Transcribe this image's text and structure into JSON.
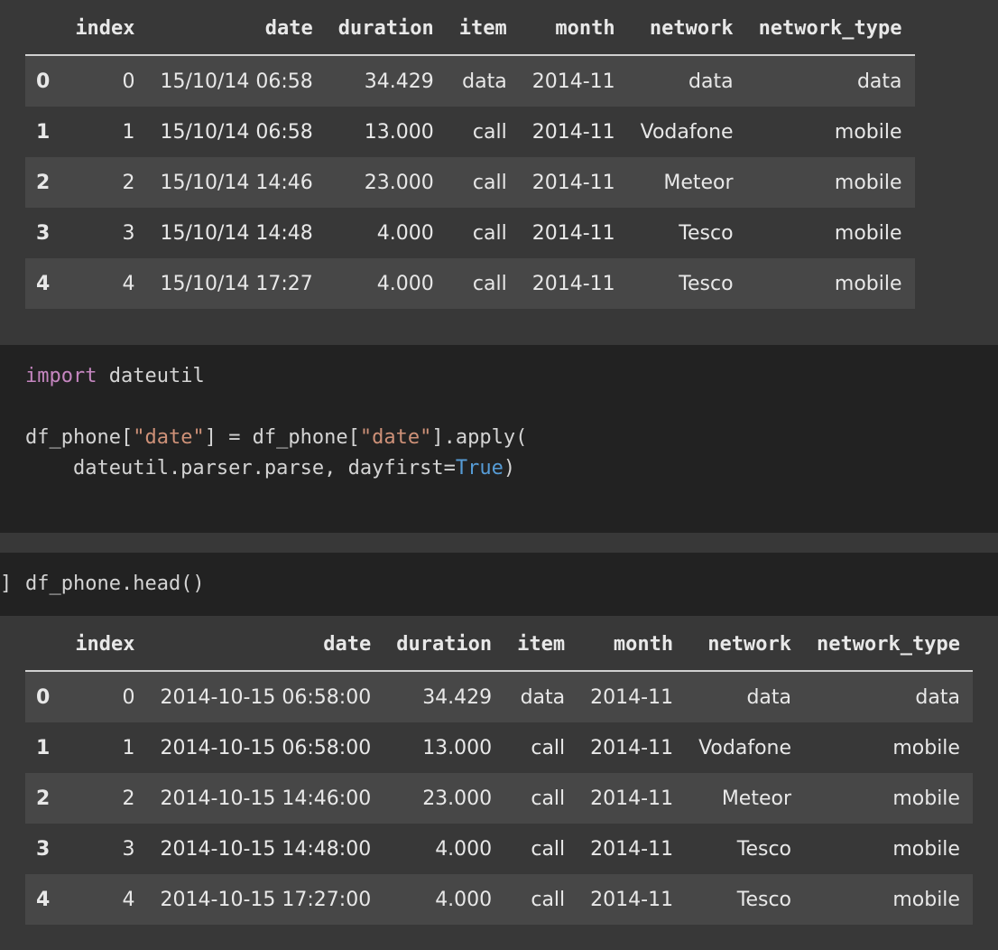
{
  "table1": {
    "columns": [
      "",
      "index",
      "date",
      "duration",
      "item",
      "month",
      "network",
      "network_type"
    ],
    "rows": [
      [
        "0",
        "0",
        "15/10/14 06:58",
        "34.429",
        "data",
        "2014-11",
        "data",
        "data"
      ],
      [
        "1",
        "1",
        "15/10/14 06:58",
        "13.000",
        "call",
        "2014-11",
        "Vodafone",
        "mobile"
      ],
      [
        "2",
        "2",
        "15/10/14 14:46",
        "23.000",
        "call",
        "2014-11",
        "Meteor",
        "mobile"
      ],
      [
        "3",
        "3",
        "15/10/14 14:48",
        "4.000",
        "call",
        "2014-11",
        "Tesco",
        "mobile"
      ],
      [
        "4",
        "4",
        "15/10/14 17:27",
        "4.000",
        "call",
        "2014-11",
        "Tesco",
        "mobile"
      ]
    ]
  },
  "code_cell_1": {
    "line1": {
      "kw": "import",
      "rest": " dateutil"
    },
    "line2": {
      "a": "df_phone[",
      "s1": "\"date\"",
      "b": "] = df_phone[",
      "s2": "\"date\"",
      "c": "].apply("
    },
    "line3": {
      "a": "    dateutil.parser.parse, dayfirst=",
      "const": "True",
      "b": ")"
    }
  },
  "code_cell_2": {
    "prompt": "]",
    "code": "df_phone.head()"
  },
  "table2": {
    "columns": [
      "",
      "index",
      "date",
      "duration",
      "item",
      "month",
      "network",
      "network_type"
    ],
    "rows": [
      [
        "0",
        "0",
        "2014-10-15 06:58:00",
        "34.429",
        "data",
        "2014-11",
        "data",
        "data"
      ],
      [
        "1",
        "1",
        "2014-10-15 06:58:00",
        "13.000",
        "call",
        "2014-11",
        "Vodafone",
        "mobile"
      ],
      [
        "2",
        "2",
        "2014-10-15 14:46:00",
        "23.000",
        "call",
        "2014-11",
        "Meteor",
        "mobile"
      ],
      [
        "3",
        "3",
        "2014-10-15 14:48:00",
        "4.000",
        "call",
        "2014-11",
        "Tesco",
        "mobile"
      ],
      [
        "4",
        "4",
        "2014-10-15 17:27:00",
        "4.000",
        "call",
        "2014-11",
        "Tesco",
        "mobile"
      ]
    ]
  },
  "colors": {
    "background": "#383838",
    "row_stripe": "#474747",
    "code_background": "#222222",
    "keyword": "#c586c0",
    "string": "#ce9178",
    "constant": "#569cd6"
  }
}
